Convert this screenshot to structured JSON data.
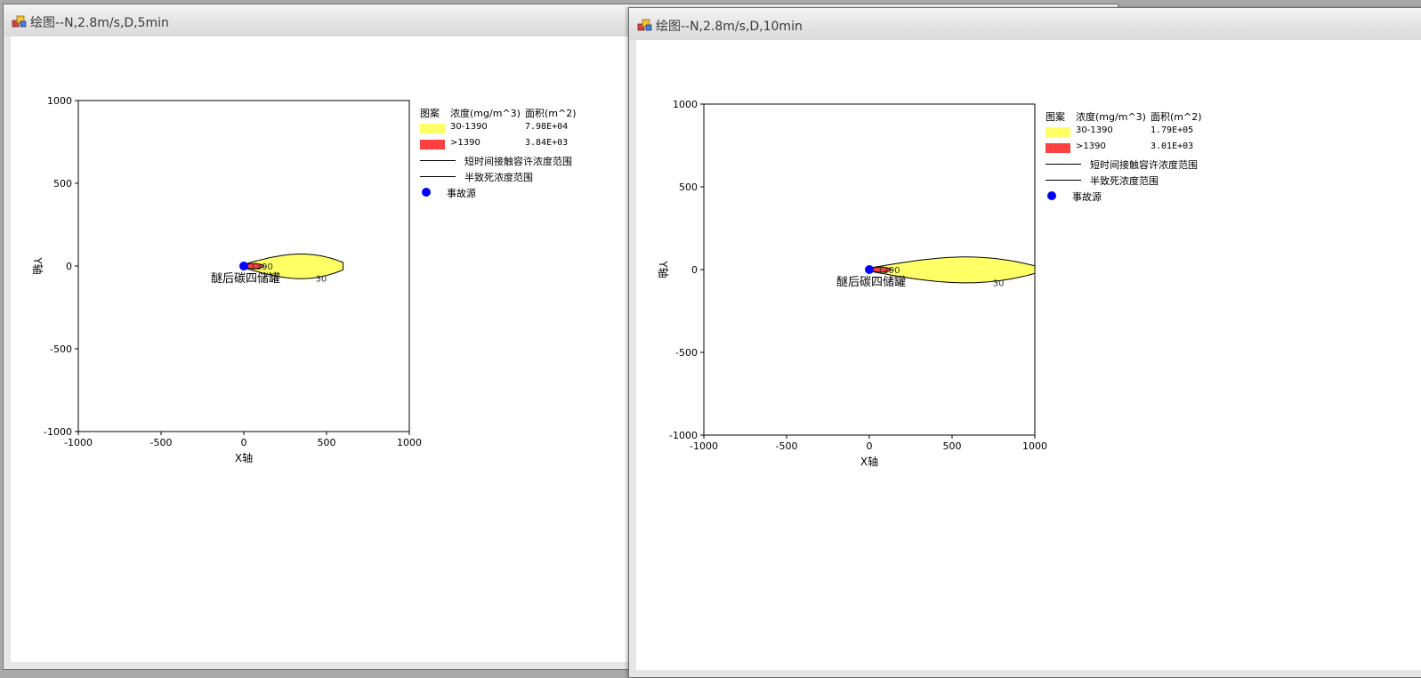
{
  "windows": [
    {
      "title": "绘图--N,2.8m/s,D,5min",
      "chart_data": {
        "type": "contour",
        "xlabel": "X轴",
        "ylabel": "Y轴",
        "xlim": [
          -1000,
          1000
        ],
        "ylim": [
          -1000,
          1000
        ],
        "xticks": [
          "-1000",
          "-500",
          "0",
          "500",
          "1000"
        ],
        "yticks": [
          "1000",
          "500",
          "0",
          "-500",
          "-1000"
        ],
        "source": {
          "x": 0,
          "y": 0,
          "label": "醚后碳四储罐"
        },
        "contours": [
          {
            "level": 30,
            "label": "30",
            "x_max": 600,
            "half_width": 105
          },
          {
            "level": 1390,
            "label": "1390",
            "x_max": 120,
            "half_width": 22
          }
        ],
        "legend": {
          "col_pattern": "图案",
          "col_conc": "浓度(mg/m^3)",
          "col_area": "面积(m^2)",
          "rows": [
            {
              "label": "30-1390",
              "area": "7.98E+04",
              "color": "#ffff66"
            },
            {
              "label": ">1390",
              "area": "3.84E+03",
              "color": "#ff4040"
            }
          ],
          "lines": [
            "短时间接触容许浓度范围",
            "半致死浓度范围"
          ],
          "source_label": "事故源"
        }
      }
    },
    {
      "title": "绘图--N,2.8m/s,D,10min",
      "chart_data": {
        "type": "contour",
        "xlabel": "X轴",
        "ylabel": "Y轴",
        "xlim": [
          -1000,
          1000
        ],
        "ylim": [
          -1000,
          1000
        ],
        "xticks": [
          "-1000",
          "-500",
          "0",
          "500",
          "1000"
        ],
        "yticks": [
          "1000",
          "500",
          "0",
          "-500",
          "-1000"
        ],
        "source": {
          "x": 0,
          "y": 0,
          "label": "醚后碳四储罐"
        },
        "contours": [
          {
            "level": 30,
            "label": "30",
            "x_max": 1000,
            "half_width": 110
          },
          {
            "level": 1390,
            "label": "1390",
            "x_max": 130,
            "half_width": 22
          }
        ],
        "legend": {
          "col_pattern": "图案",
          "col_conc": "浓度(mg/m^3)",
          "col_area": "面积(m^2)",
          "rows": [
            {
              "label": "30-1390",
              "area": "1.79E+05",
              "color": "#ffff66"
            },
            {
              "label": ">1390",
              "area": "3.01E+03",
              "color": "#ff4040"
            }
          ],
          "lines": [
            "短时间接触容许浓度范围",
            "半致死浓度范围"
          ],
          "source_label": "事故源"
        }
      }
    }
  ]
}
